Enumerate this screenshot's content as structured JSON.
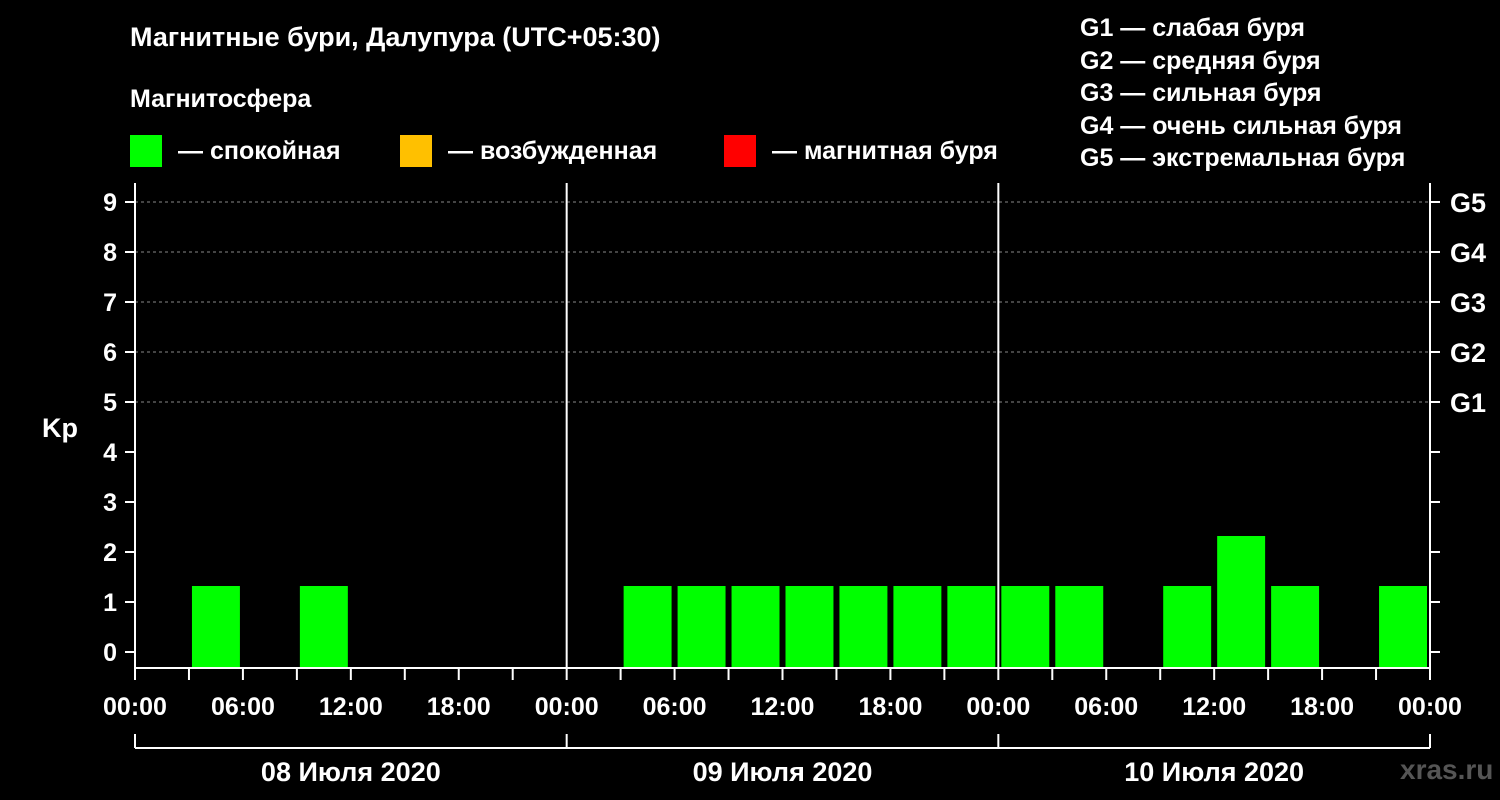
{
  "title": "Магнитные бури, Далупура (UTC+05:30)",
  "magnetosphere": {
    "heading": "Магнитосфера",
    "items": [
      {
        "label": "— спокойная",
        "color": "#00ff00"
      },
      {
        "label": "— возбужденная",
        "color": "#ffc000"
      },
      {
        "label": "— магнитная буря",
        "color": "#ff0000"
      }
    ]
  },
  "g_legend": [
    "G1 — слабая буря",
    "G2 — средняя буря",
    "G3 — сильная буря",
    "G4 — очень сильная буря",
    "G5 — экстремальная буря"
  ],
  "watermark": "xras.ru",
  "chart_data": {
    "type": "bar",
    "ylabel": "Kp",
    "ylim": [
      0,
      9
    ],
    "y_ticks": [
      "0",
      "1",
      "2",
      "3",
      "4",
      "5",
      "6",
      "7",
      "8",
      "9"
    ],
    "right_axis_labels": [
      {
        "value": 5,
        "label": "G1"
      },
      {
        "value": 6,
        "label": "G2"
      },
      {
        "value": 7,
        "label": "G3"
      },
      {
        "value": 8,
        "label": "G4"
      },
      {
        "value": 9,
        "label": "G5"
      }
    ],
    "x_tick_labels": [
      "00:00",
      "06:00",
      "12:00",
      "18:00",
      "00:00",
      "06:00",
      "12:00",
      "18:00",
      "00:00",
      "06:00",
      "12:00",
      "18:00",
      "00:00"
    ],
    "days": [
      "08 Июля 2020",
      "09 Июля 2020",
      "10 Июля 2020"
    ],
    "interval_hours": 3,
    "bars": [
      {
        "day": 0,
        "start_hour": 3,
        "kp": 1,
        "level": "quiet"
      },
      {
        "day": 0,
        "start_hour": 9,
        "kp": 1,
        "level": "quiet"
      },
      {
        "day": 1,
        "start_hour": 3,
        "kp": 1,
        "level": "quiet"
      },
      {
        "day": 1,
        "start_hour": 6,
        "kp": 1,
        "level": "quiet"
      },
      {
        "day": 1,
        "start_hour": 9,
        "kp": 1,
        "level": "quiet"
      },
      {
        "day": 1,
        "start_hour": 12,
        "kp": 1,
        "level": "quiet"
      },
      {
        "day": 1,
        "start_hour": 15,
        "kp": 1,
        "level": "quiet"
      },
      {
        "day": 1,
        "start_hour": 18,
        "kp": 1,
        "level": "quiet"
      },
      {
        "day": 1,
        "start_hour": 21,
        "kp": 1,
        "level": "quiet"
      },
      {
        "day": 2,
        "start_hour": 0,
        "kp": 1,
        "level": "quiet"
      },
      {
        "day": 2,
        "start_hour": 3,
        "kp": 1,
        "level": "quiet"
      },
      {
        "day": 2,
        "start_hour": 9,
        "kp": 1,
        "level": "quiet"
      },
      {
        "day": 2,
        "start_hour": 12,
        "kp": 2,
        "level": "quiet"
      },
      {
        "day": 2,
        "start_hour": 15,
        "kp": 1,
        "level": "quiet"
      },
      {
        "day": 2,
        "start_hour": 21,
        "kp": 1,
        "level": "quiet"
      }
    ],
    "grid": "dashed at Kp 5-9"
  }
}
